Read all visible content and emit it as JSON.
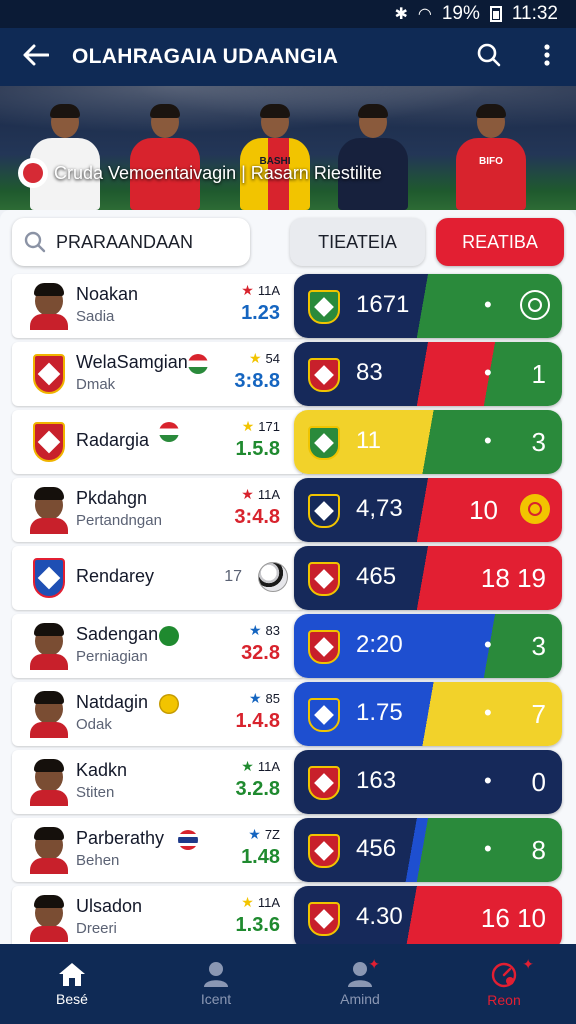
{
  "status_bar": {
    "battery": "19%",
    "time": "11:32"
  },
  "app_bar": {
    "title": "OLAHRAGAIA UDAANGIA"
  },
  "hero": {
    "caption": "Cruda Vemoentaivagin | Rasarn Riestilite",
    "jerseys": [
      "",
      "",
      "BASHI",
      "",
      "BIFO"
    ]
  },
  "search": {
    "value": "PRARAANDAAN"
  },
  "buttons": {
    "filter": "TIEATEIA",
    "result": "REATIBA"
  },
  "colors": {
    "navy": "#16295a",
    "green": "#2a8a3b",
    "red": "#e21f32",
    "yellow": "#f2d22a",
    "blue": "#1e4fd0",
    "rating_blue": "#1565c0",
    "rating_green": "#1f8a2f",
    "rating_red": "#d8232d"
  },
  "rows": [
    {
      "name": "Noakan",
      "sub": "Sadia",
      "star": "#d8232d",
      "rank": "11A",
      "rating": "1.23",
      "rating_color": "rating_blue",
      "avatar": "face",
      "score_left": "1671",
      "score_right": "",
      "emblem": true,
      "segments": [
        {
          "c": "navy",
          "p": 48
        },
        {
          "c": "green",
          "p": 52
        }
      ],
      "badge": "green"
    },
    {
      "name": "WelaSamgian",
      "sub": "Dmak",
      "star": "#f2c400",
      "rank": "54",
      "rating": "3:8.8",
      "rating_color": "rating_blue",
      "avatar": "crest",
      "flag": "hu",
      "score_left": "83",
      "score_right": "1",
      "segments": [
        {
          "c": "navy",
          "p": 48
        },
        {
          "c": "red",
          "p": 24
        },
        {
          "c": "green",
          "p": 28
        }
      ],
      "badge": "red"
    },
    {
      "name": "Radargia",
      "sub": "",
      "star": "#f2c400",
      "rank": "171",
      "rating": "1.5.8",
      "rating_color": "rating_green",
      "avatar": "crest",
      "flag": "hu",
      "score_left": "11",
      "score_right": "3",
      "segments": [
        {
          "c": "yellow",
          "p": 50
        },
        {
          "c": "green",
          "p": 50
        }
      ],
      "badge": "green"
    },
    {
      "name": "Pkdahgn",
      "sub": "Pertandngan",
      "star": "#d8232d",
      "rank": "11A",
      "rating": "3:4.8",
      "rating_color": "rating_red",
      "avatar": "face",
      "score_left": "4,73",
      "score_right": "10",
      "emblem_red": true,
      "segments": [
        {
          "c": "navy",
          "p": 48
        },
        {
          "c": "red",
          "p": 52
        }
      ],
      "badge": "navy"
    },
    {
      "name": "Rendarey",
      "sub": "",
      "star": "",
      "rank": "17",
      "rating": "",
      "rating_color": "rating_blue",
      "avatar": "crest_blue",
      "ball": true,
      "score_left": "465",
      "score_right": "18 19",
      "segments": [
        {
          "c": "navy",
          "p": 48
        },
        {
          "c": "red",
          "p": 52
        }
      ],
      "badge": "red"
    },
    {
      "name": "Sadengan",
      "sub": "Perniagian",
      "star": "#1565c0",
      "rank": "83",
      "rating": "32.8",
      "rating_color": "rating_red",
      "avatar": "face",
      "flag": "green",
      "score_left": "2:20",
      "score_right": "3",
      "segments": [
        {
          "c": "blue",
          "p": 72
        },
        {
          "c": "green",
          "p": 28
        }
      ],
      "badge": "red"
    },
    {
      "name": "Natdagin",
      "sub": "Odak",
      "star": "#1565c0",
      "rank": "85",
      "rating": "1.4.8",
      "rating_color": "rating_red",
      "avatar": "face",
      "flag": "yellow",
      "score_left": "1.75",
      "score_right": "7",
      "segments": [
        {
          "c": "blue",
          "p": 50
        },
        {
          "c": "yellow",
          "p": 50
        }
      ],
      "badge": "blue"
    },
    {
      "name": "Kadkn",
      "sub": "Stiten",
      "star": "#1f8a2f",
      "rank": "11A",
      "rating": "3.2.8",
      "rating_color": "rating_green",
      "avatar": "face",
      "score_left": "163",
      "score_right": "0",
      "segments": [
        {
          "c": "navy",
          "p": 100
        }
      ],
      "badge": "red"
    },
    {
      "name": "Parberathy",
      "sub": "Behen",
      "star": "#1565c0",
      "rank": "7Z",
      "rating": "1.48",
      "rating_color": "rating_green",
      "avatar": "face",
      "flag": "th",
      "score_left": "456",
      "score_right": "8",
      "segments": [
        {
          "c": "navy",
          "p": 44
        },
        {
          "c": "blue",
          "p": 4
        },
        {
          "c": "green",
          "p": 52
        }
      ],
      "badge": "red"
    },
    {
      "name": "Ulsadon",
      "sub": "Dreeri",
      "star": "#f2c400",
      "rank": "11A",
      "rating": "1.3.6",
      "rating_color": "rating_green",
      "avatar": "face",
      "score_left": "4.30",
      "score_right": "16 10",
      "segments": [
        {
          "c": "navy",
          "p": 44
        },
        {
          "c": "red",
          "p": 56
        }
      ],
      "badge": "red"
    }
  ],
  "nav": [
    {
      "label": "Besé",
      "icon": "home-icon"
    },
    {
      "label": "Icent",
      "icon": "person-icon"
    },
    {
      "label": "Amind",
      "icon": "person-icon"
    },
    {
      "label": "Reon",
      "icon": "gauge-icon"
    }
  ]
}
